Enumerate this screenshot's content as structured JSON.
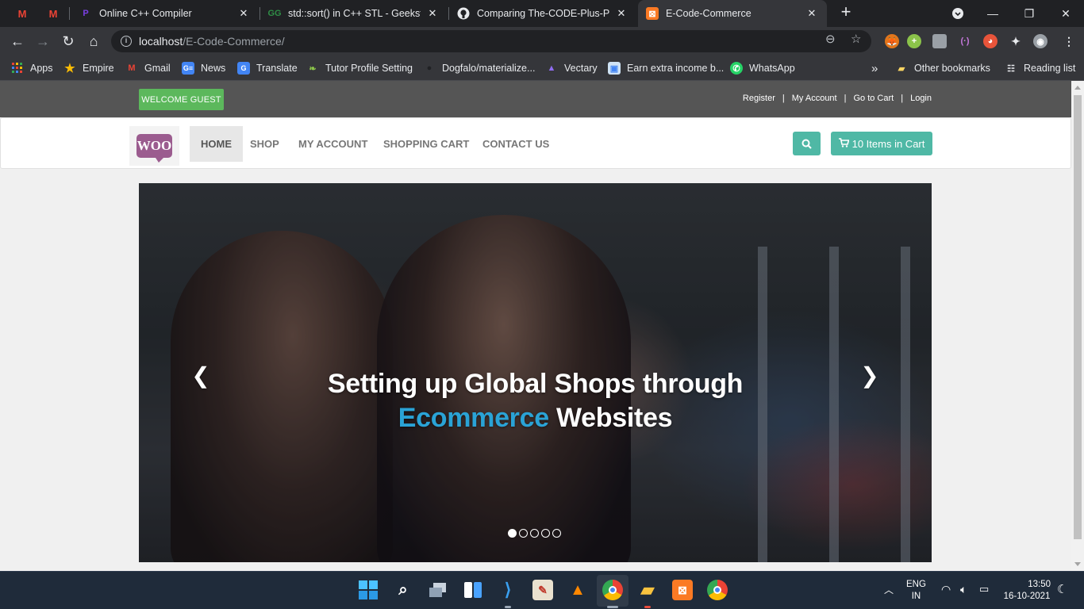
{
  "browser": {
    "tabs": [
      {
        "title": "Online C++ Compiler",
        "active": false
      },
      {
        "title": "std::sort() in C++ STL - GeeksforG",
        "active": false
      },
      {
        "title": "Comparing The-CODE-Plus-Plus-",
        "active": false
      },
      {
        "title": "E-Code-Commerce",
        "active": true
      }
    ],
    "url_host": "localhost",
    "url_path": "/E-Code-Commerce/",
    "bookmarks": [
      {
        "label": "Apps",
        "icon": "apps-grid-icon"
      },
      {
        "label": "Empire",
        "icon": "star-icon"
      },
      {
        "label": "Gmail",
        "icon": "gmail-icon"
      },
      {
        "label": "News",
        "icon": "news-icon"
      },
      {
        "label": "Translate",
        "icon": "translate-icon"
      },
      {
        "label": "Tutor Profile Setting",
        "icon": "leaf-icon"
      },
      {
        "label": "Dogfalo/materialize...",
        "icon": "github-icon"
      },
      {
        "label": "Vectary",
        "icon": "vectary-icon"
      },
      {
        "label": "Earn extra income b...",
        "icon": "image-icon"
      },
      {
        "label": "WhatsApp",
        "icon": "whatsapp-icon"
      }
    ],
    "bookmarks_overflow": "»",
    "other_bookmarks": "Other bookmarks",
    "reading_list": "Reading list"
  },
  "page": {
    "welcome": "WELCOME GUEST",
    "top_links": [
      "Register",
      "My Account",
      "Go to Cart",
      "Login"
    ],
    "logo_text": "WOO",
    "nav": [
      "HOME",
      "SHOP",
      "MY ACCOUNT",
      "SHOPPING CART",
      "CONTACT US"
    ],
    "cart_label": "10 Items in Cart",
    "slide": {
      "line1": "Setting up Global Shops through",
      "highlight": "Ecommerce",
      "line2_rest": " Websites",
      "total_slides": 5,
      "active_slide": 1
    }
  },
  "taskbar": {
    "lang_line1": "ENG",
    "lang_line2": "IN",
    "time": "13:50",
    "date": "16-10-2021"
  }
}
